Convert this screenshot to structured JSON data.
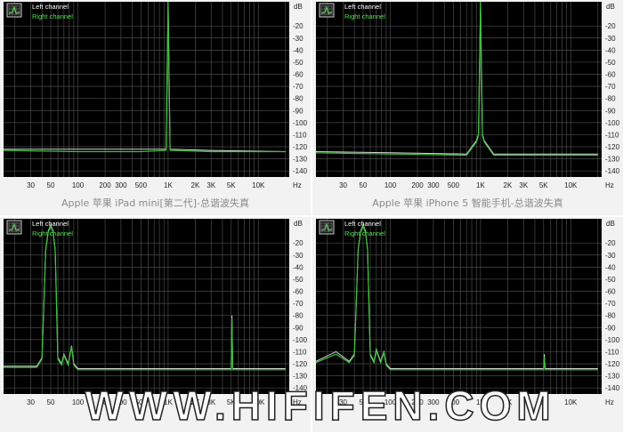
{
  "colors": {
    "plot_bg": "#000000",
    "grid": "#4a4a4a",
    "left_trace": "#d8d8d8",
    "right_trace": "#3ec23e",
    "legend_left": "#ffffff",
    "legend_right": "#55e055",
    "caption": "#8a8a8a",
    "watermark": "#ffffff"
  },
  "captions": [
    "Apple 苹果 iPad mini[第二代]-总谐波失真",
    "Apple 苹果 iPhone 5 智能手机-总谐波失真"
  ],
  "watermark": "WWW.HIFIFEN.COM",
  "chart_data": [
    {
      "type": "line",
      "legend": [
        "Left channel",
        "Right channel"
      ],
      "legend_icon": "spectrum-icon",
      "xscale": "log",
      "xlim": [
        15,
        22000
      ],
      "x_ticks": [
        30,
        50,
        100,
        200,
        300,
        500,
        1000,
        2000,
        3000,
        5000,
        10000
      ],
      "x_tick_labels": [
        "30",
        "50",
        "100",
        "200",
        "300",
        "500",
        "1K",
        "2K",
        "3K",
        "5K",
        "10K"
      ],
      "x_unit": "Hz",
      "ylim": [
        -145,
        0
      ],
      "y_ticks": [
        -20,
        -30,
        -40,
        -50,
        -60,
        -70,
        -80,
        -90,
        -100,
        -110,
        -120,
        -130,
        -140
      ],
      "y_unit": "dB",
      "grid": true,
      "series": [
        {
          "name": "Left channel",
          "x": [
            15,
            100,
            500,
            950,
            1000,
            1050,
            3000,
            20000
          ],
          "y": [
            -122,
            -122,
            -122,
            -122,
            0,
            -122,
            -123,
            -124
          ]
        },
        {
          "name": "Right channel",
          "x": [
            15,
            100,
            500,
            950,
            1000,
            1050,
            3000,
            20000
          ],
          "y": [
            -123,
            -124,
            -124,
            -123,
            0,
            -123,
            -124,
            -124
          ]
        }
      ]
    },
    {
      "type": "line",
      "legend": [
        "Left channel",
        "Right channel"
      ],
      "legend_icon": "spectrum-icon",
      "xscale": "log",
      "xlim": [
        15,
        22000
      ],
      "x_ticks": [
        30,
        50,
        100,
        200,
        300,
        500,
        1000,
        2000,
        3000,
        5000,
        10000
      ],
      "x_tick_labels": [
        "30",
        "50",
        "100",
        "200",
        "300",
        "500",
        "1K",
        "2K",
        "3K",
        "5K",
        "10K"
      ],
      "x_unit": "Hz",
      "ylim": [
        -145,
        0
      ],
      "y_ticks": [
        -20,
        -30,
        -40,
        -50,
        -60,
        -70,
        -80,
        -90,
        -100,
        -110,
        -120,
        -130,
        -140
      ],
      "y_unit": "dB",
      "grid": true,
      "series": [
        {
          "name": "Left channel",
          "x": [
            15,
            100,
            700,
            900,
            950,
            1000,
            1050,
            1100,
            1400,
            20000
          ],
          "y": [
            -124,
            -125,
            -126,
            -115,
            -110,
            0,
            -110,
            -115,
            -126,
            -126
          ]
        },
        {
          "name": "Right channel",
          "x": [
            15,
            100,
            700,
            900,
            950,
            1000,
            1050,
            1100,
            1400,
            20000
          ],
          "y": [
            -125,
            -126,
            -127,
            -116,
            -111,
            0,
            -111,
            -116,
            -127,
            -127
          ]
        }
      ]
    },
    {
      "type": "line",
      "legend": [
        "Left channel",
        "Right channel"
      ],
      "legend_icon": "spectrum-icon",
      "xscale": "log",
      "xlim": [
        15,
        22000
      ],
      "x_ticks": [
        30,
        50,
        100,
        200,
        300,
        500,
        1000,
        2000,
        3000,
        5000,
        10000
      ],
      "x_tick_labels": [
        "30",
        "50",
        "100",
        "200",
        "300",
        "500",
        "1K",
        "2K",
        "3K",
        "5K",
        "10K"
      ],
      "x_unit": "Hz",
      "ylim": [
        -145,
        0
      ],
      "y_ticks": [
        -20,
        -30,
        -40,
        -50,
        -60,
        -70,
        -80,
        -90,
        -100,
        -110,
        -120,
        -130,
        -140
      ],
      "y_unit": "dB",
      "grid": true,
      "series": [
        {
          "name": "Left channel",
          "x": [
            15,
            35,
            40,
            44,
            47,
            50,
            53,
            56,
            60,
            66,
            70,
            78,
            85,
            90,
            100,
            150,
            1000,
            3000,
            5000,
            5100,
            5200,
            20000
          ],
          "y": [
            -122,
            -122,
            -115,
            -25,
            -10,
            -5,
            -10,
            -25,
            -115,
            -120,
            -112,
            -120,
            -105,
            -120,
            -124,
            -124,
            -124,
            -124,
            -124,
            -80,
            -124,
            -124
          ]
        },
        {
          "name": "Right channel",
          "x": [
            15,
            35,
            40,
            44,
            47,
            50,
            53,
            56,
            60,
            66,
            70,
            78,
            85,
            90,
            100,
            150,
            1000,
            3000,
            5000,
            5100,
            5200,
            20000
          ],
          "y": [
            -123,
            -123,
            -116,
            -26,
            -11,
            -6,
            -11,
            -26,
            -116,
            -121,
            -113,
            -121,
            -106,
            -121,
            -125,
            -125,
            -125,
            -125,
            -125,
            -82,
            -125,
            -125
          ]
        }
      ]
    },
    {
      "type": "line",
      "legend": [
        "Left channel",
        "Right channel"
      ],
      "legend_icon": "spectrum-icon",
      "xscale": "log",
      "xlim": [
        15,
        22000
      ],
      "x_ticks": [
        30,
        50,
        100,
        200,
        300,
        500,
        1000,
        2000,
        3000,
        5000,
        10000
      ],
      "x_tick_labels": [
        "30",
        "50",
        "100",
        "200",
        "300",
        "500",
        "1K",
        "2K",
        "3K",
        "5K",
        "10K"
      ],
      "x_unit": "Hz",
      "ylim": [
        -145,
        0
      ],
      "y_ticks": [
        -20,
        -30,
        -40,
        -50,
        -60,
        -70,
        -80,
        -90,
        -100,
        -110,
        -120,
        -130,
        -140
      ],
      "y_unit": "dB",
      "grid": true,
      "series": [
        {
          "name": "Left channel",
          "x": [
            15,
            25,
            35,
            40,
            44,
            47,
            50,
            53,
            56,
            60,
            66,
            70,
            78,
            85,
            90,
            100,
            150,
            1000,
            3000,
            5000,
            5100,
            5200,
            20000
          ],
          "y": [
            -118,
            -110,
            -118,
            -112,
            -25,
            -10,
            -5,
            -10,
            -25,
            -112,
            -118,
            -108,
            -118,
            -110,
            -120,
            -124,
            -124,
            -124,
            -124,
            -124,
            -112,
            -124,
            -124
          ]
        },
        {
          "name": "Right channel",
          "x": [
            15,
            25,
            35,
            40,
            44,
            47,
            50,
            53,
            56,
            60,
            66,
            70,
            78,
            85,
            90,
            100,
            150,
            1000,
            3000,
            5000,
            5100,
            5200,
            20000
          ],
          "y": [
            -119,
            -112,
            -119,
            -113,
            -26,
            -11,
            -6,
            -11,
            -26,
            -113,
            -119,
            -109,
            -119,
            -111,
            -121,
            -125,
            -125,
            -125,
            -125,
            -125,
            -114,
            -125,
            -125
          ]
        }
      ]
    }
  ]
}
